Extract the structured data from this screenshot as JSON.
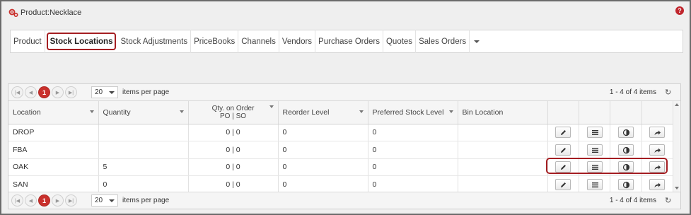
{
  "window": {
    "title": "Product:Necklace",
    "help": "?"
  },
  "tabs": [
    {
      "label": "Product"
    },
    {
      "label": "Stock Locations",
      "active": true
    },
    {
      "label": "Stock Adjustments"
    },
    {
      "label": "PriceBooks"
    },
    {
      "label": "Channels"
    },
    {
      "label": "Vendors"
    },
    {
      "label": "Purchase Orders"
    },
    {
      "label": "Quotes"
    },
    {
      "label": "Sales Orders"
    }
  ],
  "pager": {
    "current_page": "1",
    "page_size": "20",
    "page_size_label": "items per page",
    "summary": "1 - 4 of 4 items",
    "icons": [
      "first-page-icon",
      "prev-page-icon",
      "next-page-icon",
      "last-page-icon",
      "refresh-icon"
    ]
  },
  "columns": {
    "location": "Location",
    "quantity": "Quantity",
    "qty_on_order_line1": "Qty. on Order",
    "qty_on_order_line2": "PO | SO",
    "reorder_level": "Reorder Level",
    "preferred_stock_level": "Preferred Stock Level",
    "bin_location": "Bin Location"
  },
  "rows": [
    {
      "location": "DROP",
      "quantity": "",
      "qty_on_order": "0 | 0",
      "reorder_level": "0",
      "preferred_stock_level": "0",
      "bin_location": ""
    },
    {
      "location": "FBA",
      "quantity": "",
      "qty_on_order": "0 | 0",
      "reorder_level": "0",
      "preferred_stock_level": "0",
      "bin_location": ""
    },
    {
      "location": "OAK",
      "quantity": "5",
      "qty_on_order": "0 | 0",
      "reorder_level": "0",
      "preferred_stock_level": "0",
      "bin_location": ""
    },
    {
      "location": "SAN",
      "quantity": "0",
      "qty_on_order": "0 | 0",
      "reorder_level": "0",
      "preferred_stock_level": "0",
      "bin_location": ""
    }
  ],
  "row_actions": [
    "edit-icon",
    "list-icon",
    "contrast-icon",
    "share-icon"
  ],
  "colors": {
    "accent": "#c9302c",
    "highlight_border": "#a41e22"
  }
}
